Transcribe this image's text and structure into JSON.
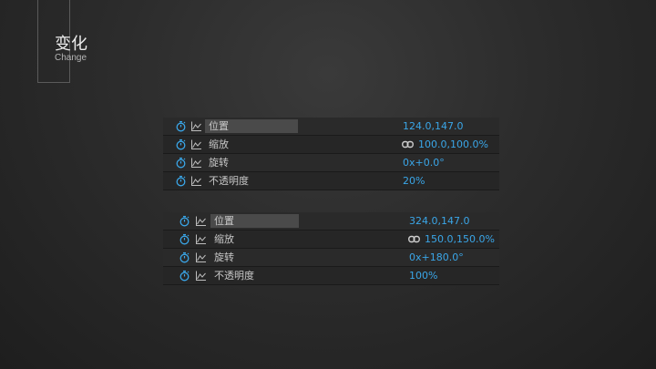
{
  "header": {
    "title": "变化",
    "subtitle": "Change"
  },
  "panels": [
    {
      "rows": [
        {
          "label": "位置",
          "value": "124.0,147.0"
        },
        {
          "label": "缩放",
          "value": "100.0,100.0%"
        },
        {
          "label": "旋转",
          "value": "0x+0.0°"
        },
        {
          "label": "不透明度",
          "value": "20%"
        }
      ]
    },
    {
      "rows": [
        {
          "label": "位置",
          "value": "324.0,147.0"
        },
        {
          "label": "缩放",
          "value": "150.0,150.0%"
        },
        {
          "label": "旋转",
          "value": "0x+180.0°"
        },
        {
          "label": "不透明度",
          "value": "100%"
        }
      ]
    }
  ],
  "icons": {
    "stopwatch": "stopwatch-icon",
    "graph": "graph-icon",
    "link": "link-icon"
  },
  "colors": {
    "value": "#3aa6e8",
    "stopwatch": "#3aa6e8"
  }
}
